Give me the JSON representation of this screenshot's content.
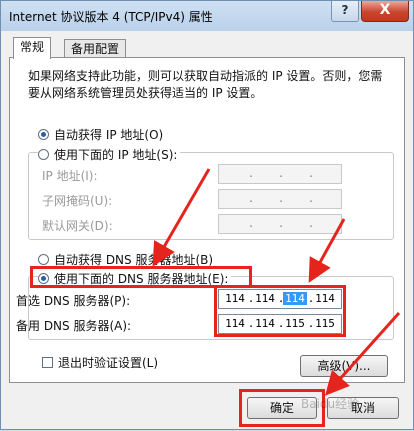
{
  "window": {
    "title": "Internet 协议版本 4 (TCP/IPv4) 属性",
    "help_glyph": "?",
    "close_glyph": "X"
  },
  "tabs": [
    {
      "label": "常规",
      "active": true
    },
    {
      "label": "备用配置",
      "active": false
    }
  ],
  "description": "如果网络支持此功能，则可以获取自动指派的 IP 设置。否则，您需要从网络系统管理员处获得适当的 IP 设置。",
  "ip_section": {
    "auto_label": "自动获得 IP 地址(O)",
    "manual_label": "使用下面的 IP 地址(S):",
    "selected": "auto",
    "fields": [
      {
        "label": "IP 地址(I):",
        "segments": [
          "",
          "",
          "",
          ""
        ]
      },
      {
        "label": "子网掩码(U):",
        "segments": [
          "",
          "",
          "",
          ""
        ]
      },
      {
        "label": "默认网关(D):",
        "segments": [
          "",
          "",
          "",
          ""
        ]
      }
    ]
  },
  "dns_section": {
    "auto_label": "自动获得 DNS 服务器地址(B)",
    "manual_label": "使用下面的 DNS 服务器地址(E):",
    "selected": "manual",
    "preferred": {
      "label": "首选 DNS 服务器(P):",
      "segments": [
        "114",
        "114",
        "114",
        "114"
      ]
    },
    "alternate": {
      "label": "备用 DNS 服务器(A):",
      "segments": [
        "114",
        "114",
        "115",
        "115"
      ]
    }
  },
  "validate_on_exit": {
    "label": "退出时验证设置(L)",
    "checked": false
  },
  "buttons": {
    "advanced": "高级(V)...",
    "ok": "确定",
    "cancel": "取消"
  },
  "colors": {
    "highlight_box": "#e5251d",
    "selection": "#3399ff"
  },
  "watermark": "Baidu经验"
}
